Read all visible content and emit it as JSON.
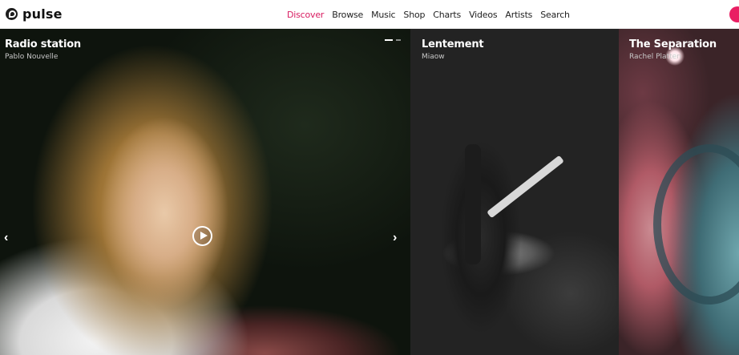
{
  "brand": {
    "name": "pulse",
    "icon": "pulse-logo-icon"
  },
  "nav": {
    "items": [
      {
        "label": "Discover",
        "active": true
      },
      {
        "label": "Browse",
        "active": false
      },
      {
        "label": "Music",
        "active": false
      },
      {
        "label": "Shop",
        "active": false
      },
      {
        "label": "Charts",
        "active": false
      },
      {
        "label": "Videos",
        "active": false
      },
      {
        "label": "Artists",
        "active": false
      },
      {
        "label": "Search",
        "active": false
      }
    ],
    "active_color": "#d81b60"
  },
  "slides": [
    {
      "title": "Radio station",
      "artist": "Pablo Nouvelle"
    },
    {
      "title": "Lentement",
      "artist": "Miaow"
    },
    {
      "title": "The Separation",
      "artist": "Rachel Platten"
    }
  ],
  "carousel": {
    "prev_icon": "chevron-left-icon",
    "next_icon": "chevron-right-icon",
    "play_icon": "play-circle-icon",
    "prev_glyph": "‹",
    "next_glyph": "›"
  },
  "colors": {
    "accent": "#e91e63",
    "header_bg": "#ffffff"
  }
}
